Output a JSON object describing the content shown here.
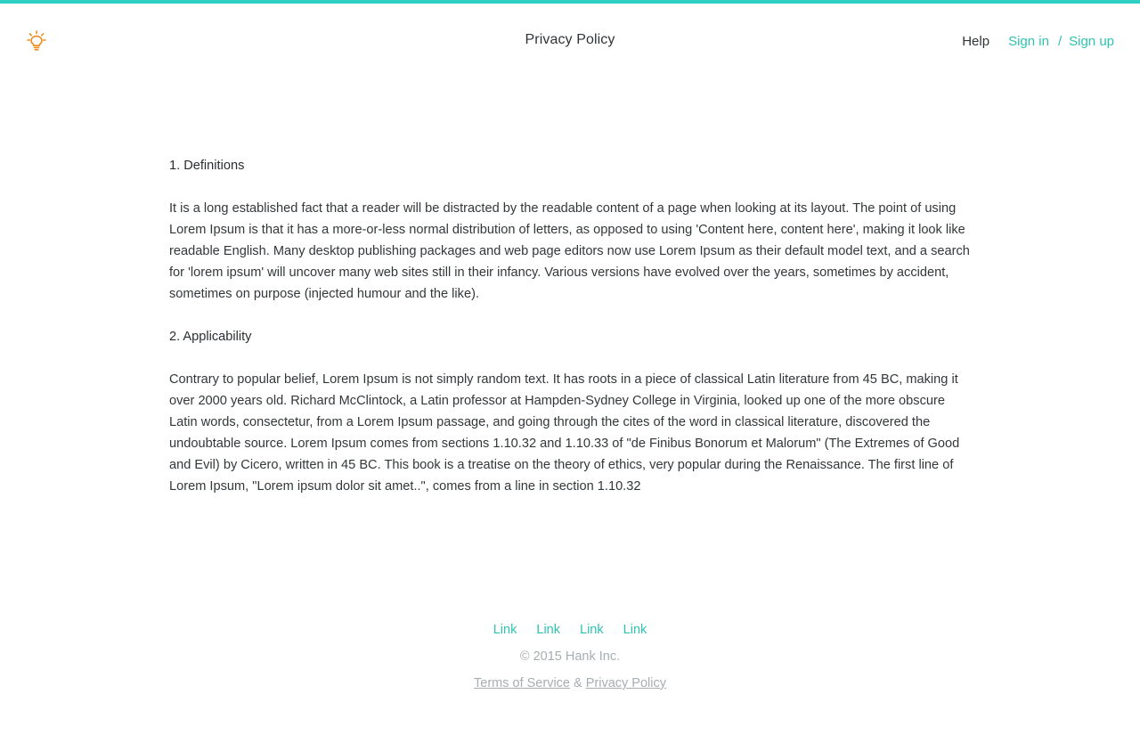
{
  "colors": {
    "accent": "#2fd0c4",
    "link": "#2fc2b0",
    "logo": "#f08a1c",
    "muted": "#a8adb0",
    "text": "#2f3437"
  },
  "header": {
    "logo_icon": "lightbulb-icon",
    "title": "Privacy Policy",
    "help_label": "Help",
    "sign_in_label": "Sign in",
    "separator": "/",
    "sign_up_label": "Sign up"
  },
  "content": {
    "sections": [
      {
        "heading": "1. Definitions",
        "body": "It is a long established fact that a reader will be distracted by the readable content of a page when looking at its layout. The point of using Lorem Ipsum is that it has a more-or-less normal distribution of letters, as opposed to using 'Content here, content here', making it look like readable English. Many desktop publishing packages and web page editors now use Lorem Ipsum as their default model text, and a search for 'lorem ipsum' will uncover many web sites still in their infancy. Various versions have evolved over the years, sometimes by accident, sometimes on purpose (injected humour and the like)."
      },
      {
        "heading": "2. Applicability",
        "body": "Contrary to popular belief, Lorem Ipsum is not simply random text. It has roots in a piece of classical Latin literature from 45 BC, making it over 2000 years old. Richard McClintock, a Latin professor at Hampden-Sydney College in Virginia, looked up one of the more obscure Latin words, consectetur, from a Lorem Ipsum passage, and going through the cites of the word in classical literature, discovered the undoubtable source. Lorem Ipsum comes from sections 1.10.32 and 1.10.33 of \"de Finibus Bonorum et Malorum\" (The Extremes of Good and Evil) by Cicero, written in 45 BC. This book is a treatise on the theory of ethics, very popular during the Renaissance. The first line of Lorem Ipsum, \"Lorem ipsum dolor sit amet..\", comes from a line in section 1.10.32"
      }
    ]
  },
  "footer": {
    "links": [
      "Link",
      "Link",
      "Link",
      "Link"
    ],
    "copyright": "© 2015 Hank Inc.",
    "terms_label": "Terms of Service",
    "amp": "&",
    "privacy_label": "Privacy Policy"
  }
}
